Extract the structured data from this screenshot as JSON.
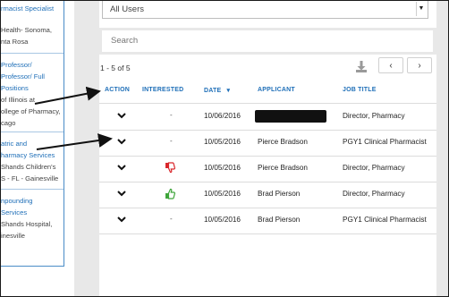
{
  "sidebar": {
    "blocks": [
      {
        "title": [
          "rmacist Specialist"
        ],
        "text": [
          "Health- Sonoma,",
          "nta Rosa"
        ]
      },
      {
        "title": [
          "Professor/",
          "Professor/ Full",
          "Positions"
        ],
        "text": [
          "of Illinois at",
          "ollege of Pharmacy,",
          "cago"
        ]
      },
      {
        "title": [
          "atric and",
          "harmacy Services"
        ],
        "text": [
          "Shands Children's",
          "S - FL - Gainesville"
        ]
      },
      {
        "title": [
          "npounding",
          "Services"
        ],
        "text": [
          "Shands Hospital,",
          "inesville"
        ]
      }
    ]
  },
  "filter": {
    "selected": "All Users"
  },
  "search": {
    "placeholder": "Search"
  },
  "results": {
    "count": "1 - 5 of 5"
  },
  "pagination": {
    "prev": "‹",
    "next": "›"
  },
  "table": {
    "headers": {
      "action": "ACTION",
      "interested": "INTERESTED",
      "date": "DATE",
      "applicant": "APPLICANT",
      "job_title": "JOB TITLE"
    },
    "sort_indicator": "▾",
    "rows": [
      {
        "interested": "-",
        "interest_state": "none",
        "date": "10/06/2016",
        "applicant": "",
        "redacted": true,
        "job_title": "Director, Pharmacy"
      },
      {
        "interested": "-",
        "interest_state": "none",
        "date": "10/05/2016",
        "applicant": "Pierce Bradson",
        "redacted": false,
        "job_title": "PGY1 Clinical Pharmacist"
      },
      {
        "interested": "",
        "interest_state": "thumbs-down",
        "date": "10/05/2016",
        "applicant": "Pierce Bradson",
        "redacted": false,
        "job_title": "Director, Pharmacy"
      },
      {
        "interested": "",
        "interest_state": "thumbs-up",
        "date": "10/05/2016",
        "applicant": "Brad Pierson",
        "redacted": false,
        "job_title": "Director, Pharmacy"
      },
      {
        "interested": "-",
        "interest_state": "none",
        "date": "10/05/2016",
        "applicant": "Brad Pierson",
        "redacted": false,
        "job_title": "PGY1 Clinical Pharmacist"
      }
    ]
  },
  "icons": {
    "download": "download-icon",
    "expand": "chevron-down-icon",
    "thumbs_down": "thumbs-down-icon",
    "thumbs_up": "thumbs-up-icon"
  },
  "colors": {
    "accent": "#1f6fb8",
    "thumbs_down": "#d9262b",
    "thumbs_up": "#3ea53a",
    "gutter": "#e8e8e8",
    "annotation_arrow": "#111111"
  }
}
